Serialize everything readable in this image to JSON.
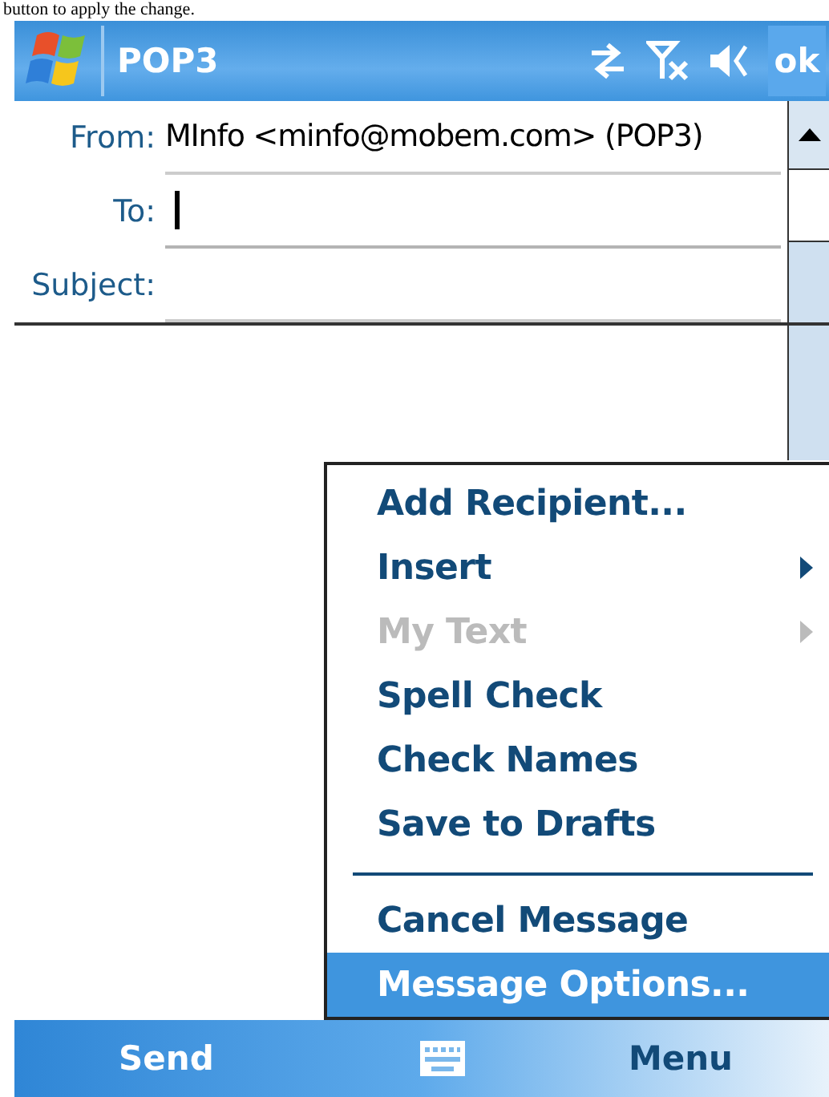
{
  "caption": "button to apply the change.",
  "title_bar": {
    "title": "POP3",
    "ok_button": "ok"
  },
  "header_fields": [
    {
      "label": "From:",
      "value": "MInfo <minfo@mobem.com> (POP3)",
      "focused": false
    },
    {
      "label": "To:",
      "focused": true
    },
    {
      "label": "Subject:",
      "focused": false
    }
  ],
  "menu": [
    {
      "kind": "item",
      "label": "Add Recipient...",
      "disabled": false,
      "submenu": false,
      "selected": false
    },
    {
      "kind": "item",
      "label": "Insert",
      "disabled": false,
      "submenu": true,
      "selected": false
    },
    {
      "kind": "item",
      "label": "My Text",
      "disabled": true,
      "submenu": true,
      "selected": false
    },
    {
      "kind": "item",
      "label": "Spell Check",
      "disabled": false,
      "submenu": false,
      "selected": false
    },
    {
      "kind": "item",
      "label": "Check Names",
      "disabled": false,
      "submenu": false,
      "selected": false
    },
    {
      "kind": "item",
      "label": "Save to Drafts",
      "disabled": false,
      "submenu": false,
      "selected": false
    },
    {
      "kind": "separator"
    },
    {
      "kind": "item",
      "label": "Cancel Message",
      "disabled": false,
      "submenu": false,
      "selected": false
    },
    {
      "kind": "item",
      "label": "Message Options...",
      "disabled": false,
      "submenu": false,
      "selected": true
    }
  ],
  "soft_keys": {
    "left": "Send",
    "right": "Menu"
  }
}
